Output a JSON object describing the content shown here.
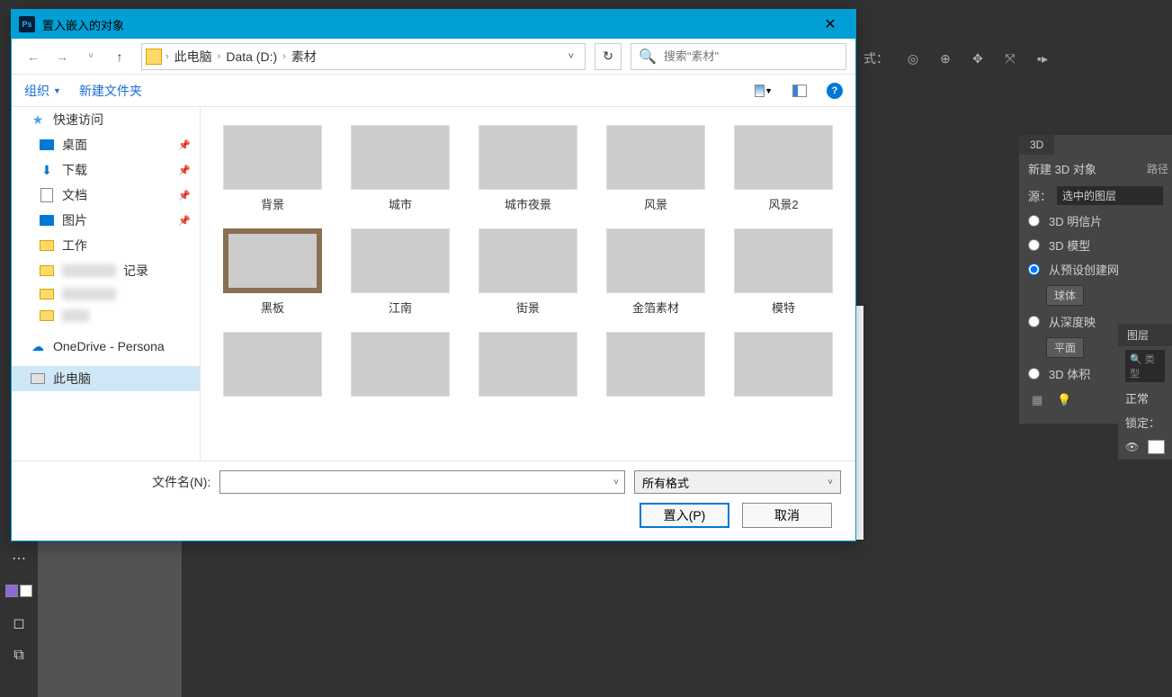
{
  "ps": {
    "mode_label": "式：",
    "canvas_bg": "#ffffff"
  },
  "panel3d": {
    "tab": "3D",
    "header": "新建 3D 对象",
    "side_tab": "路径",
    "source_label": "源：",
    "source_value": "选中的图层",
    "opt_postcard": "3D 明信片",
    "opt_model": "3D 模型",
    "opt_preset": "从预设创建网",
    "preset_value": "球体",
    "opt_depth": "从深度映",
    "depth_value": "平面",
    "opt_volume": "3D 体积"
  },
  "layers": {
    "tab": "图层",
    "type_placeholder": "类型",
    "blend": "正常",
    "lock_label": "锁定："
  },
  "dialog": {
    "title": "置入嵌入的对象",
    "breadcrumb": [
      "此电脑",
      "Data (D:)",
      "素材"
    ],
    "search_placeholder": "搜索\"素材\"",
    "organize": "组织",
    "new_folder": "新建文件夹",
    "sidebar": {
      "quick_access": "快速访问",
      "desktop": "桌面",
      "downloads": "下载",
      "documents": "文档",
      "pictures": "图片",
      "work": "工作",
      "blur_suffix": "记录",
      "onedrive": "OneDrive - Persona",
      "this_pc": "此电脑"
    },
    "files": [
      {
        "name": "背景",
        "cls": "th-sky"
      },
      {
        "name": "城市",
        "cls": "th-city"
      },
      {
        "name": "城市夜景",
        "cls": "th-night"
      },
      {
        "name": "风景",
        "cls": "th-green"
      },
      {
        "name": "风景2",
        "cls": "th-green2"
      },
      {
        "name": "黑板",
        "cls": "th-black"
      },
      {
        "name": "江南",
        "cls": "th-jn"
      },
      {
        "name": "街景",
        "cls": "th-street"
      },
      {
        "name": "金箔素材",
        "cls": "th-gold"
      },
      {
        "name": "模特",
        "cls": "th-model"
      },
      {
        "name": "",
        "cls": "th-p1"
      },
      {
        "name": "",
        "cls": "th-p2"
      },
      {
        "name": "",
        "cls": "th-p3"
      },
      {
        "name": "",
        "cls": "th-p4"
      },
      {
        "name": "",
        "cls": "th-p5"
      }
    ],
    "filename_label": "文件名(N):",
    "filename_value": "",
    "format": "所有格式",
    "btn_place": "置入(P)",
    "btn_cancel": "取消"
  }
}
